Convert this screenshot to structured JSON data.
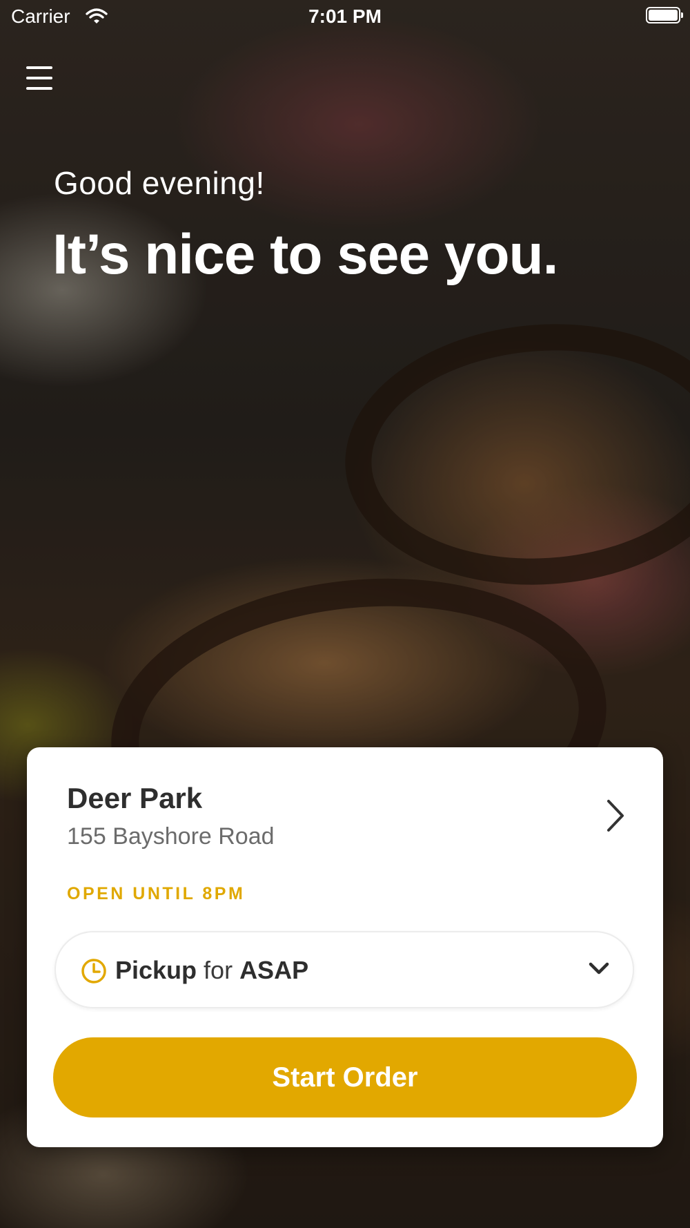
{
  "status_bar": {
    "carrier": "Carrier",
    "time": "7:01 PM"
  },
  "hero": {
    "greeting": "Good evening!",
    "headline": "It’s nice to see you."
  },
  "location": {
    "name": "Deer Park",
    "address": "155 Bayshore Road",
    "hours": "OPEN UNTIL 8PM"
  },
  "order_type": {
    "mode": "Pickup",
    "connector": "for",
    "time": "ASAP"
  },
  "actions": {
    "start_order": "Start Order"
  },
  "colors": {
    "accent": "#e2a800",
    "card_background": "#ffffff",
    "text_primary": "#2e2e2e",
    "text_secondary": "#6b6b6b"
  },
  "icons": [
    "menu-icon",
    "wifi-icon",
    "battery-icon",
    "chevron-right-icon",
    "clock-icon",
    "chevron-down-icon"
  ]
}
